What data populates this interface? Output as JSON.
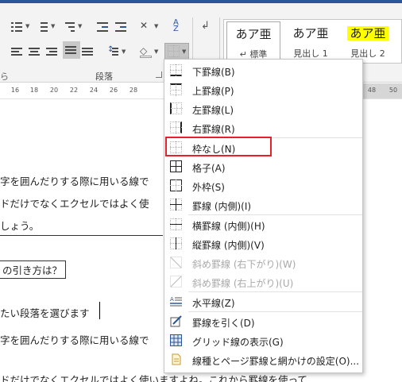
{
  "ribbon": {
    "group_label": "段落",
    "edge_label": "ら",
    "style_gallery": [
      {
        "sample": "あア亜",
        "name": "↵ 標準"
      },
      {
        "sample": "あア亜",
        "name": "見出し 1"
      },
      {
        "sample": "あア亜",
        "name": "見出し 2"
      }
    ]
  },
  "ruler": {
    "numbers": [
      "16",
      "18",
      "20",
      "22",
      "24",
      "26",
      "28",
      "48",
      "50"
    ]
  },
  "document": {
    "lines": [
      "字を囲んだりする際に用いる線で",
      "ドだけでなくエクセルではよく使",
      "しょう。",
      "の引き方は？",
      "たい段落を選びます",
      "字を囲んだりする際に用いる線で",
      "ドだけでなくエクセルではよく使いますよね。これから罫線を使って"
    ]
  },
  "border_menu": {
    "items": [
      {
        "label": "下罫線(B)",
        "icon": "bottom-border-icon",
        "enabled": true
      },
      {
        "label": "上罫線(P)",
        "icon": "top-border-icon",
        "enabled": true
      },
      {
        "label": "左罫線(L)",
        "icon": "left-border-icon",
        "enabled": true
      },
      {
        "label": "右罫線(R)",
        "icon": "right-border-icon",
        "enabled": true
      },
      {
        "label": "枠なし(N)",
        "icon": "no-border-icon",
        "enabled": true,
        "highlighted": true
      },
      {
        "label": "格子(A)",
        "icon": "all-borders-icon",
        "enabled": true
      },
      {
        "label": "外枠(S)",
        "icon": "outside-borders-icon",
        "enabled": true
      },
      {
        "label": "罫線 (内側)(I)",
        "icon": "inside-borders-icon",
        "enabled": true
      },
      {
        "label": "横罫線 (内側)(H)",
        "icon": "inside-horizontal-border-icon",
        "enabled": true
      },
      {
        "label": "縦罫線 (内側)(V)",
        "icon": "inside-vertical-border-icon",
        "enabled": true
      },
      {
        "label": "斜め罫線 (右下がり)(W)",
        "icon": "diagonal-down-border-icon",
        "enabled": false
      },
      {
        "label": "斜め罫線 (右上がり)(U)",
        "icon": "diagonal-up-border-icon",
        "enabled": false
      },
      {
        "label": "水平線(Z)",
        "icon": "horizontal-line-icon",
        "enabled": true
      },
      {
        "label": "罫線を引く(D)",
        "icon": "draw-table-icon",
        "enabled": true
      },
      {
        "label": "グリッド線の表示(G)",
        "icon": "view-gridlines-icon",
        "enabled": true
      },
      {
        "label": "線種とページ罫線と網かけの設定(O)...",
        "icon": "borders-and-shading-icon",
        "enabled": true
      }
    ]
  },
  "colors": {
    "title_bar": "#2b579a",
    "highlight_box": "#e8202a",
    "heading2_highlight": "#ffff00"
  }
}
